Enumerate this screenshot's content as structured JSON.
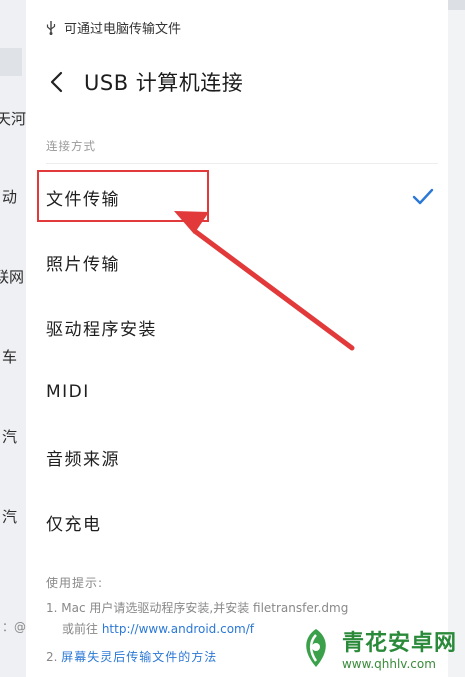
{
  "background": {
    "fragments": [
      "天河",
      "动",
      "联网",
      "车",
      "汽",
      "汽"
    ],
    "side_small": "：@"
  },
  "notification": {
    "text": "可通过电脑传输文件",
    "icon": "usb-icon"
  },
  "header": {
    "title": "USB 计算机连接",
    "back_icon": "back-arrow-icon"
  },
  "section_label": "连接方式",
  "options": [
    {
      "label": "文件传输",
      "selected": true
    },
    {
      "label": "照片传输",
      "selected": false
    },
    {
      "label": "驱动程序安装",
      "selected": false
    },
    {
      "label": "MIDI",
      "selected": false
    },
    {
      "label": "音频来源",
      "selected": false
    },
    {
      "label": "仅充电",
      "selected": false
    }
  ],
  "tips": {
    "title": "使用提示:",
    "tip1_prefix": "1. Mac 用户请选驱动程序安装,并安装 filetransfer.dmg",
    "tip1_line2_prefix": "或前往 ",
    "tip1_link": "http://www.android.com/f",
    "tip2_prefix": "2. ",
    "tip2_link": "屏幕失灵后传输文件的方法"
  },
  "watermark": {
    "name": "青花安卓网",
    "url": "www.qhhlv.com"
  },
  "colors": {
    "accent": "#2b78d6",
    "highlight": "#e23a3a",
    "check": "#2b78d6",
    "watermark": "#2a8a3a"
  }
}
